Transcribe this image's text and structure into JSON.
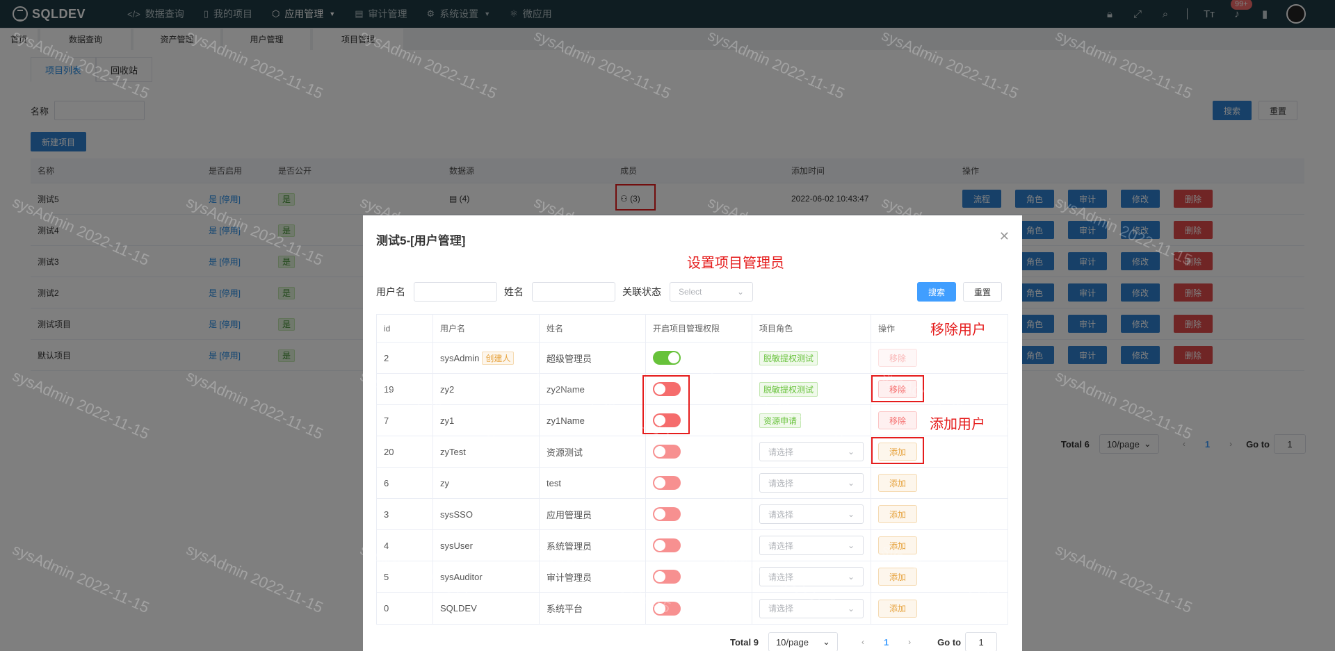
{
  "app": {
    "logo": "SQLDEV"
  },
  "topnav": {
    "items": [
      {
        "label": "数据查询",
        "icon": "code-icon"
      },
      {
        "label": "我的项目",
        "icon": "book-icon"
      },
      {
        "label": "应用管理",
        "icon": "cube-icon",
        "active": true,
        "dropdown": true
      },
      {
        "label": "审计管理",
        "icon": "clipboard-icon"
      },
      {
        "label": "系统设置",
        "icon": "gear-icon",
        "dropdown": true
      },
      {
        "label": "微应用",
        "icon": "atom-icon"
      }
    ],
    "notification_count": "99+"
  },
  "tabs": [
    "首页",
    "数据查询",
    "资产管理",
    "用户管理",
    "项目管理"
  ],
  "page": {
    "subtabs": [
      "项目列表",
      "回收站"
    ],
    "name_label": "名称",
    "search_label": "搜索",
    "reset_label": "重置",
    "new_project_label": "新建项目",
    "table": {
      "headers": [
        "名称",
        "是否启用",
        "是否公开",
        "数据源",
        "成员",
        "添加时间",
        "操作"
      ],
      "rows": [
        {
          "name": "测试5",
          "enabled": "是 [停用]",
          "public": "是",
          "datasource": "▤ (4)",
          "members": "⚇ (3)",
          "time": "2022-06-02 10:43:47"
        },
        {
          "name": "测试4",
          "enabled": "是 [停用]",
          "public": "是",
          "datasource": "",
          "members": "",
          "time": ""
        },
        {
          "name": "测试3",
          "enabled": "是 [停用]",
          "public": "是",
          "datasource": "",
          "members": "",
          "time": ""
        },
        {
          "name": "测试2",
          "enabled": "是 [停用]",
          "public": "是",
          "datasource": "",
          "members": "",
          "time": ""
        },
        {
          "name": "测试项目",
          "enabled": "是 [停用]",
          "public": "是",
          "datasource": "",
          "members": "",
          "time": ""
        },
        {
          "name": "默认项目",
          "enabled": "是 [停用]",
          "public": "是",
          "datasource": "",
          "members": "",
          "time": ""
        }
      ],
      "actions": [
        "流程",
        "角色",
        "审计",
        "修改",
        "删除"
      ]
    },
    "pager": {
      "total": "Total 6",
      "page_size": "10/page",
      "current": "1",
      "goto_label": "Go to",
      "goto_value": "1"
    }
  },
  "watermark": "sysAdmin 2022-11-15",
  "dialog": {
    "title": "测试5-[用户管理]",
    "annotations": {
      "admin": "设置项目管理员",
      "remove": "移除用户",
      "add": "添加用户"
    },
    "filters": {
      "username_label": "用户名",
      "realname_label": "姓名",
      "status_label": "关联状态",
      "status_placeholder": "Select",
      "search_label": "搜索",
      "reset_label": "重置"
    },
    "headers": [
      "id",
      "用户名",
      "姓名",
      "开启项目管理权限",
      "项目角色",
      "操作"
    ],
    "rows": [
      {
        "id": "2",
        "username": "sysAdmin",
        "creator": "创建人",
        "realname": "超级管理员",
        "switch": "on",
        "role": "脱敏提权测试",
        "action": "移除",
        "action_type": "remove-disabled"
      },
      {
        "id": "19",
        "username": "zy2",
        "creator": "",
        "realname": "zy2Name",
        "switch": "off",
        "role": "脱敏提权测试",
        "action": "移除",
        "action_type": "remove"
      },
      {
        "id": "7",
        "username": "zy1",
        "creator": "",
        "realname": "zy1Name",
        "switch": "off",
        "role": "资源申请",
        "action": "移除",
        "action_type": "remove"
      },
      {
        "id": "20",
        "username": "zyTest",
        "creator": "",
        "realname": "资源测试",
        "switch": "off-faded",
        "role": "",
        "role_placeholder": "请选择",
        "action": "添加",
        "action_type": "add"
      },
      {
        "id": "6",
        "username": "zy",
        "creator": "",
        "realname": "test",
        "switch": "off-faded",
        "role": "",
        "role_placeholder": "请选择",
        "action": "添加",
        "action_type": "add"
      },
      {
        "id": "3",
        "username": "sysSSO",
        "creator": "",
        "realname": "应用管理员",
        "switch": "off-faded",
        "role": "",
        "role_placeholder": "请选择",
        "action": "添加",
        "action_type": "add"
      },
      {
        "id": "4",
        "username": "sysUser",
        "creator": "",
        "realname": "系统管理员",
        "switch": "off-faded",
        "role": "",
        "role_placeholder": "请选择",
        "action": "添加",
        "action_type": "add"
      },
      {
        "id": "5",
        "username": "sysAuditor",
        "creator": "",
        "realname": "审计管理员",
        "switch": "off-faded",
        "role": "",
        "role_placeholder": "请选择",
        "action": "添加",
        "action_type": "add"
      },
      {
        "id": "0",
        "username": "SQLDEV",
        "creator": "",
        "realname": "系统平台",
        "switch": "off-faded",
        "role": "",
        "role_placeholder": "请选择",
        "action": "添加",
        "action_type": "add"
      }
    ],
    "pager": {
      "total": "Total 9",
      "page_size": "10/page",
      "current": "1",
      "goto_label": "Go to",
      "goto_value": "1"
    }
  },
  "colors": {
    "nav_bg": "#1e3a44",
    "primary": "#409eff",
    "danger": "#f56c6c",
    "success": "#67c23a",
    "warning": "#e6a23c",
    "annotation": "#e51c1c"
  }
}
